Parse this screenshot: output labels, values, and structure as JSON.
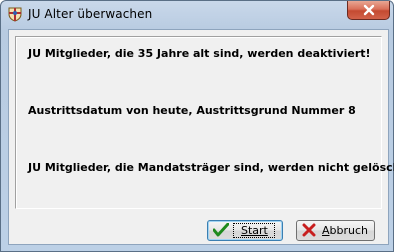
{
  "window": {
    "title": "JU Alter überwachen",
    "app_icon": "shield-crest-icon",
    "close_icon": "close-icon"
  },
  "messages": [
    "JU Mitglieder, die 35 Jahre alt sind, werden deaktiviert!",
    "Austrittsdatum von heute, Austrittsgrund Nummer 8",
    "JU Mitglieder, die Mandatsträger sind, werden nicht gelöscht!"
  ],
  "buttons": {
    "start_label": "Start",
    "start_icon": "checkmark-icon",
    "cancel_label_first": "A",
    "cancel_label_rest": "bbruch",
    "cancel_icon": "red-x-icon"
  },
  "colors": {
    "check_green": "#1e8a1e",
    "cancel_red": "#c81e1e",
    "close_red": "#c44a31"
  }
}
